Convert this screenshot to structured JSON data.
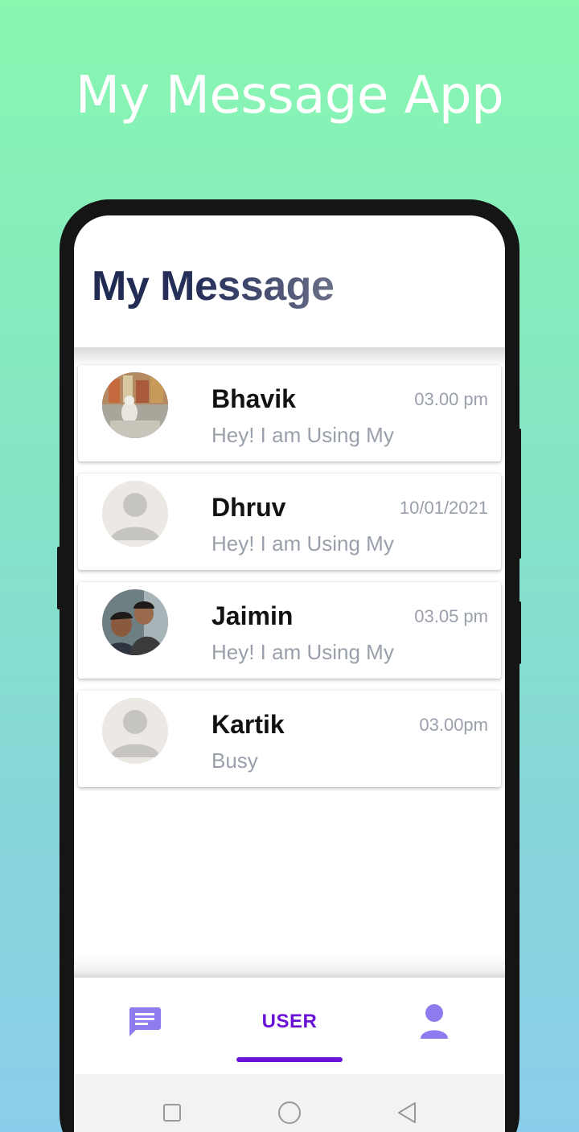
{
  "headline": "My Message App",
  "app": {
    "title": "My Message"
  },
  "chats": [
    {
      "name": "Bhavik",
      "time": "03.00 pm",
      "status": "Hey! I am Using My",
      "avatar": "photo"
    },
    {
      "name": "Dhruv",
      "time": "10/01/2021",
      "status": "Hey! I am Using My",
      "avatar": "default-person-icon"
    },
    {
      "name": "Jaimin",
      "time": "03.05 pm",
      "status": "Hey! I am Using My",
      "avatar": "photo"
    },
    {
      "name": "Kartik",
      "time": "03.00pm",
      "status": "Busy",
      "avatar": "default-person-icon"
    }
  ],
  "tabs": {
    "chat_icon": "chat-icon",
    "user_label": "USER",
    "profile_icon": "person-icon",
    "active": "USER"
  },
  "nav": {
    "recent_icon": "square-icon",
    "home_icon": "circle-icon",
    "back_icon": "triangle-back-icon"
  },
  "colors": {
    "accent": "#6a12d6",
    "icon_purple": "#8f7af0",
    "title_navy": "#1f2a52",
    "muted_text": "#9aa0ab",
    "bg_top": "#88f7b0",
    "bg_bottom": "#8acdea"
  }
}
